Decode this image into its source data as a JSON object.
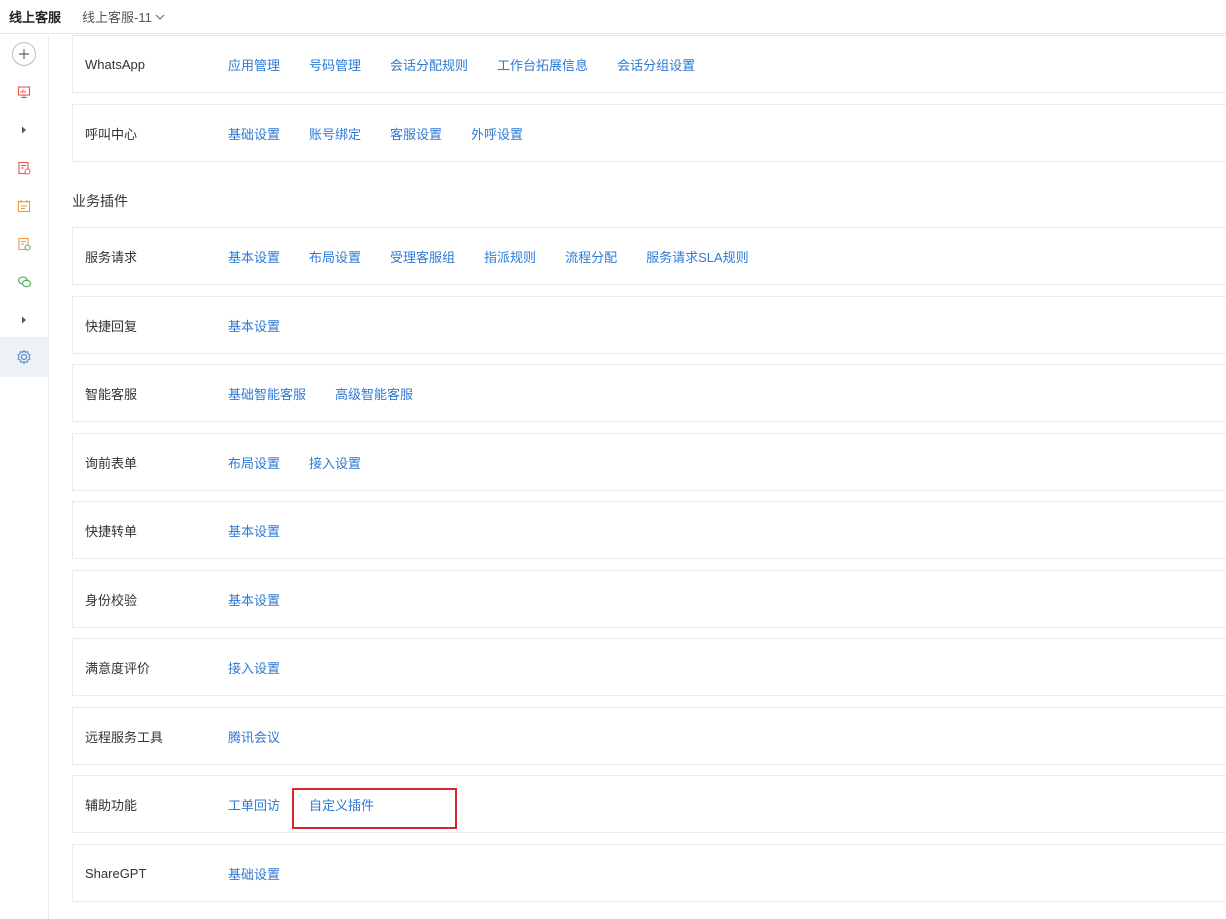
{
  "header": {
    "app_title": "线上客服",
    "workspace": "线上客服-11"
  },
  "sidebar": {
    "icons": [
      "plus-icon",
      "monitor-icon",
      "expand-arrow-icon",
      "report-icon",
      "calendar-icon",
      "document-settings-icon",
      "wechat-icon",
      "expand-arrow-icon",
      "settings-icon"
    ],
    "colors": {
      "red": "#e8554e",
      "orange": "#f29a38",
      "green": "#4caf50",
      "blue": "#5b8bd6",
      "gray": "#6b6b6b"
    }
  },
  "channels": [
    {
      "label": "WhatsApp",
      "links": [
        "应用管理",
        "号码管理",
        "会话分配规则",
        "工作台拓展信息",
        "会话分组设置"
      ]
    },
    {
      "label": "呼叫中心",
      "links": [
        "基础设置",
        "账号绑定",
        "客服设置",
        "外呼设置"
      ]
    }
  ],
  "plugins_section": {
    "title": "业务插件",
    "rows": [
      {
        "label": "服务请求",
        "links": [
          "基本设置",
          "布局设置",
          "受理客服组",
          "指派规则",
          "流程分配",
          "服务请求SLA规则"
        ]
      },
      {
        "label": "快捷回复",
        "links": [
          "基本设置"
        ]
      },
      {
        "label": "智能客服",
        "links": [
          "基础智能客服",
          "高级智能客服"
        ]
      },
      {
        "label": "询前表单",
        "links": [
          "布局设置",
          "接入设置"
        ]
      },
      {
        "label": "快捷转单",
        "links": [
          "基本设置"
        ]
      },
      {
        "label": "身份校验",
        "links": [
          "基本设置"
        ]
      },
      {
        "label": "满意度评价",
        "links": [
          "接入设置"
        ]
      },
      {
        "label": "远程服务工具",
        "links": [
          "腾讯会议"
        ]
      },
      {
        "label": "辅助功能",
        "links": [
          "工单回访",
          "自定义插件"
        ]
      },
      {
        "label": "ShareGPT",
        "links": [
          "基础设置"
        ]
      }
    ]
  },
  "colors": {
    "link": "#2d7ad6",
    "highlight": "#d9252f"
  }
}
